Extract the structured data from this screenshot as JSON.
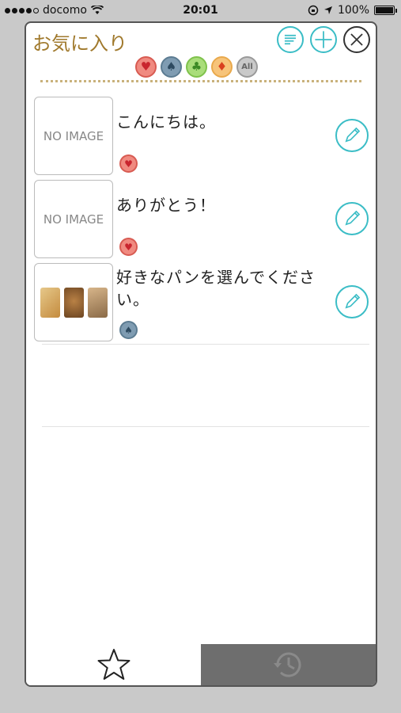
{
  "status_bar": {
    "carrier": "docomo",
    "time": "20:01",
    "battery": "100%"
  },
  "header": {
    "title": "お気に入り",
    "buttons": [
      {
        "name": "sort",
        "icon": "sort-lines-icon"
      },
      {
        "name": "add",
        "icon": "plus-icon"
      },
      {
        "name": "close",
        "icon": "close-icon"
      }
    ]
  },
  "filters": [
    {
      "suit": "heart",
      "glyph": "♥"
    },
    {
      "suit": "spade",
      "glyph": "♠"
    },
    {
      "suit": "club",
      "glyph": "♣"
    },
    {
      "suit": "diamond",
      "glyph": "♦"
    },
    {
      "suit": "all",
      "glyph": "All"
    }
  ],
  "items": [
    {
      "text": "こんにちは。",
      "thumb": "NO IMAGE",
      "suit_glyph": "♥"
    },
    {
      "text": "ありがとう！",
      "thumb": "NO IMAGE",
      "suit_glyph": "♥"
    },
    {
      "text": "好きなパンを選んでください。",
      "thumb": "",
      "suit_glyph": "♠"
    }
  ],
  "tabs": [
    {
      "name": "favorites",
      "icon": "star-icon",
      "active": true
    },
    {
      "name": "history",
      "icon": "history-clock-icon",
      "active": false
    }
  ],
  "colors": {
    "accent": "#3bbdc6",
    "title": "#a0792c",
    "frame": "#555555"
  }
}
